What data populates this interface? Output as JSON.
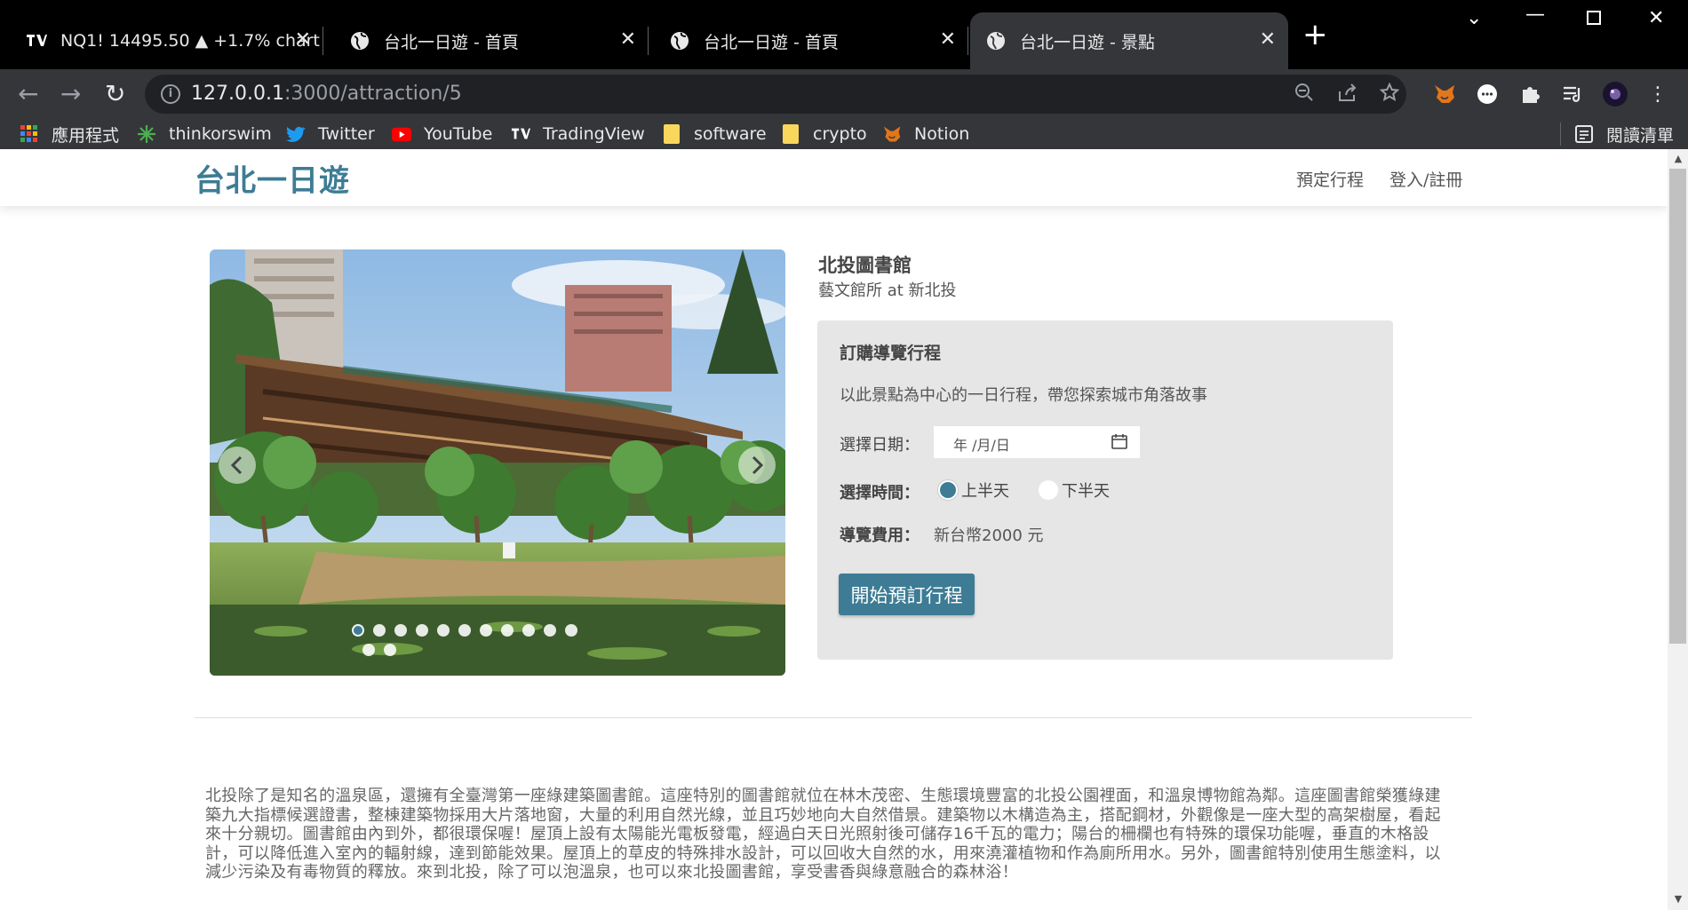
{
  "browser": {
    "tabs": [
      {
        "title": "NQ1! 14495.50 ▲ +1.7% chart",
        "icon": "tradingview-icon",
        "active": false
      },
      {
        "title": "台北一日遊 - 首頁",
        "icon": "globe-icon",
        "active": false
      },
      {
        "title": "台北一日遊 - 首頁",
        "icon": "globe-icon",
        "active": false
      },
      {
        "title": "台北一日遊 - 景點",
        "icon": "globe-icon",
        "active": true
      }
    ],
    "url_host": "127.0.0.1",
    "url_rest": ":3000/attraction/5",
    "bookmarks": [
      {
        "label": "應用程式",
        "icon": "apps-grid-icon"
      },
      {
        "label": "thinkorswim",
        "icon": "thinkorswim-icon"
      },
      {
        "label": "Twitter",
        "icon": "twitter-icon"
      },
      {
        "label": "YouTube",
        "icon": "youtube-icon"
      },
      {
        "label": "TradingView",
        "icon": "tradingview-icon"
      },
      {
        "label": "software",
        "icon": "folder-icon"
      },
      {
        "label": "crypto",
        "icon": "folder-icon"
      },
      {
        "label": "Notion",
        "icon": "fox-icon"
      }
    ],
    "reading_list": "閱讀清單"
  },
  "site": {
    "brand": "台北一日遊",
    "nav": {
      "schedule": "預定行程",
      "login": "登入/註冊"
    }
  },
  "attraction": {
    "name": "北投圖書館",
    "category_line": "藝文館所 at 新北投",
    "carousel": {
      "image_count": 13,
      "active_index": 0
    },
    "description": "北投除了是知名的溫泉區，還擁有全臺灣第一座綠建築圖書館。這座特別的圖書館就位在林木茂密、生態環境豐富的北投公園裡面，和溫泉博物館為鄰。這座圖書館榮獲綠建築九大指標候選證書，整棟建築物採用大片落地窗，大量的利用自然光線，並且巧妙地向大自然借景。建築物以木構造為主，搭配鋼材，外觀像是一座大型的高架樹屋，看起來十分親切。圖書館由內到外，都很環保喔！屋頂上設有太陽能光電板發電，經過白天日光照射後可儲存16千瓦的電力；陽台的柵欄也有特殊的環保功能喔，垂直的木格設計，可以降低進入室內的輻射線，達到節能效果。屋頂上的草皮的特殊排水設計，可以回收大自然的水，用來澆灌植物和作為廁所用水。另外，圖書館特別使用生態塗料，以減少污染及有毒物質的釋放。來到北投，除了可以泡溫泉，也可以來北投圖書館，享受書香與綠意融合的森林浴！"
  },
  "booking": {
    "title": "訂購導覽行程",
    "description": "以此景點為中心的一日行程，帶您探索城市角落故事",
    "date_label": "選擇日期：",
    "date_placeholder": "年 /月/日",
    "time_label": "選擇時間：",
    "time_options": [
      {
        "label": "上半天",
        "selected": true
      },
      {
        "label": "下半天",
        "selected": false
      }
    ],
    "fee_label": "導覽費用：",
    "fee_value": "新台幣2000 元",
    "submit": "開始預訂行程"
  },
  "colors": {
    "brand": "#3d7c94"
  }
}
